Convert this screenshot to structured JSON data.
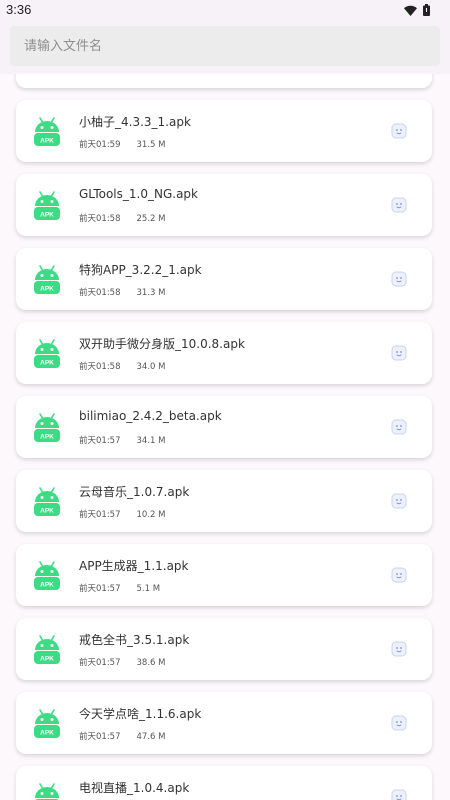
{
  "status_bar": {
    "time": "3:36"
  },
  "search": {
    "placeholder": "请输入文件名",
    "value": ""
  },
  "files": [
    {
      "name": "小柚子_4.3.3_1.apk",
      "date": "前天01:59",
      "size": "31.5 M",
      "icon": "android-apk-icon",
      "badge": "APK"
    },
    {
      "name": "GLTools_1.0_NG.apk",
      "date": "前天01:58",
      "size": "25.2 M",
      "icon": "android-apk-icon",
      "badge": "APK"
    },
    {
      "name": "特狗APP_3.2.2_1.apk",
      "date": "前天01:58",
      "size": "31.3 M",
      "icon": "android-apk-icon",
      "badge": "APK"
    },
    {
      "name": "双开助手微分身版_10.0.8.apk",
      "date": "前天01:58",
      "size": "34.0 M",
      "icon": "android-apk-icon",
      "badge": "APK"
    },
    {
      "name": "bilimiao_2.4.2_beta.apk",
      "date": "前天01:57",
      "size": "34.1 M",
      "icon": "android-apk-icon",
      "badge": "APK"
    },
    {
      "name": "云母音乐_1.0.7.apk",
      "date": "前天01:57",
      "size": "10.2 M",
      "icon": "android-apk-icon",
      "badge": "APK"
    },
    {
      "name": "APP生成器_1.1.apk",
      "date": "前天01:57",
      "size": "5.1 M",
      "icon": "android-apk-icon",
      "badge": "APK"
    },
    {
      "name": "戒色全书_3.5.1.apk",
      "date": "前天01:57",
      "size": "38.6 M",
      "icon": "android-apk-icon",
      "badge": "APK"
    },
    {
      "name": "今天学点啥_1.1.6.apk",
      "date": "前天01:57",
      "size": "47.6 M",
      "icon": "android-apk-icon",
      "badge": "APK"
    },
    {
      "name": "电视直播_1.0.4.apk",
      "date": "",
      "size": "",
      "icon": "android-apk-icon",
      "badge": "APK"
    }
  ],
  "colors": {
    "android_green": "#3ddc84",
    "background": "#fcf8fc",
    "card": "#ffffff",
    "action_icon": "#7a8fd8"
  }
}
